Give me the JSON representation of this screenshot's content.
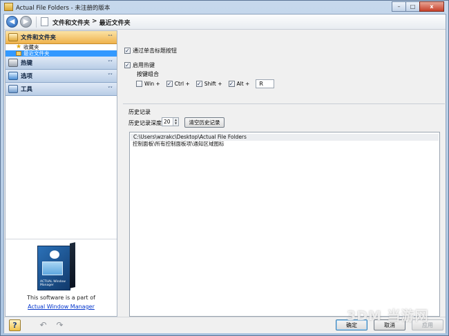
{
  "window": {
    "title": "Actual File Folders - 未注册的版本",
    "controls": {
      "minimize": "–",
      "maximize": "□",
      "close": "x"
    }
  },
  "nav": {
    "back_glyph": "◀",
    "forward_glyph": "▶",
    "breadcrumb": [
      "文件和文件夹",
      ">",
      "最近文件夹"
    ]
  },
  "sidebar": {
    "sections": [
      {
        "label": "文件和文件夹",
        "icon": "folder-icon",
        "chevron": "˄˄",
        "active": true,
        "items": [
          {
            "label": "收藏夹",
            "icon": "star-icon"
          },
          {
            "label": "最近文件夹",
            "icon": "recent-folder-icon",
            "selected": true
          }
        ]
      },
      {
        "label": "热键",
        "icon": "keyboard-icon",
        "chevron": "˅˅"
      },
      {
        "label": "选项",
        "icon": "options-icon",
        "chevron": "˅˅"
      },
      {
        "label": "工具",
        "icon": "tools-icon",
        "chevron": "˅˅"
      }
    ],
    "promo": {
      "box_name": "ACTUAL Window Manager",
      "text": "This software is a part of",
      "link": "Actual Window Manager"
    }
  },
  "main": {
    "options": {
      "single_click": {
        "label": "通过单击标题按钮",
        "checked": true
      },
      "enable_hotkey": {
        "label": "启用热键",
        "checked": true
      },
      "hotkey_group_label": "按键组合",
      "keys": [
        {
          "label": "Win +",
          "checked": false
        },
        {
          "label": "Ctrl +",
          "checked": true
        },
        {
          "label": "Shift +",
          "checked": true
        },
        {
          "label": "Alt +",
          "checked": true
        }
      ],
      "key_value": "R"
    },
    "history": {
      "title": "历史记录",
      "depth_label": "历史记录深度",
      "depth_value": "20",
      "clear_button": "清空历史记录",
      "items": [
        "C:\\Users\\wzrakc\\Desktop\\Actual File Folders",
        "控制面板\\所有控制面板项\\通知区域图标"
      ]
    }
  },
  "bottom": {
    "ok": "确定",
    "cancel": "取消",
    "apply": "应用",
    "help_glyph": "?",
    "undo_glyph": "↶",
    "redo_glyph": "↷"
  },
  "watermark": "3DM 当游网",
  "colors": {
    "selection": "#3399ff",
    "active_section": "#efb24c",
    "link": "#0033cc"
  }
}
